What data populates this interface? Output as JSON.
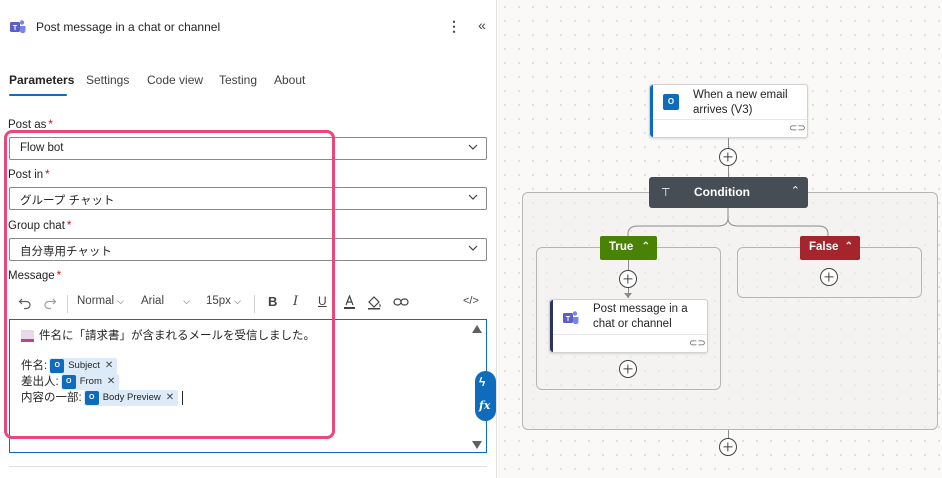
{
  "panel": {
    "title": "Post message in a chat or channel",
    "more_icon": "more-vertical-icon",
    "collapse_icon": "double-chevron-left-icon",
    "tabs": [
      {
        "label": "Parameters",
        "active": true
      },
      {
        "label": "Settings",
        "active": false
      },
      {
        "label": "Code view",
        "active": false
      },
      {
        "label": "Testing",
        "active": false
      },
      {
        "label": "About",
        "active": false
      }
    ],
    "fields": {
      "post_as": {
        "label": "Post as",
        "required": "*",
        "value": "Flow bot"
      },
      "post_in": {
        "label": "Post in",
        "required": "*",
        "value": "グループ チャット"
      },
      "group_chat": {
        "label": "Group chat",
        "required": "*",
        "value": "自分専用チャット"
      },
      "message": {
        "label": "Message",
        "required": "*"
      }
    },
    "toolbar": {
      "style": "Normal",
      "font": "Arial",
      "size": "15px"
    },
    "editor": {
      "line1": "件名に「請求書」が含まれるメールを受信しました。",
      "line2_label": "件名:",
      "line2_token": "Subject",
      "line3_label": "差出人:",
      "line3_token": "From",
      "line4_label": "内容の一部:",
      "line4_token": "Body Preview",
      "token_remove": "✕",
      "side_btn_dynamic": "ϟ",
      "side_btn_fx": "fx"
    }
  },
  "canvas": {
    "trigger": {
      "label": "When a new email arrives (V3)"
    },
    "condition": {
      "label": "Condition"
    },
    "true_branch": {
      "label": "True"
    },
    "false_branch": {
      "label": "False"
    },
    "action": {
      "label": "Post message in a chat or channel"
    }
  },
  "colors": {
    "accent": "#0f6cbd",
    "highlight": "#e8487a",
    "true": "#498205",
    "false": "#a4262c",
    "condition": "#464d55",
    "teams": "#5b5fc7"
  }
}
